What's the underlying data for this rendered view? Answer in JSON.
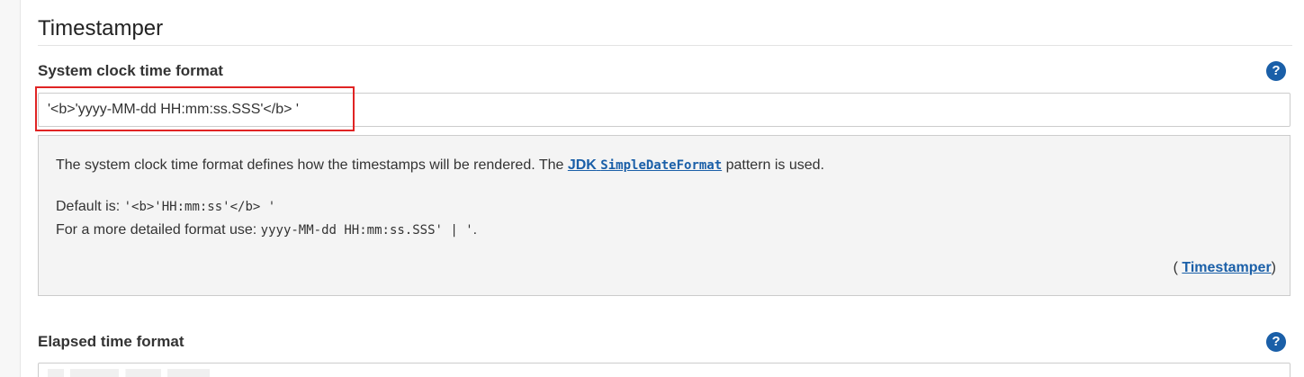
{
  "section": {
    "title": "Timestamper"
  },
  "system_clock": {
    "label": "System clock time format",
    "value": "'<b>'yyyy-MM-dd HH:mm:ss.SSS'</b> '",
    "help_icon": "question-circle-icon",
    "help": {
      "line1_prefix": "The system clock time format defines how the timestamps will be rendered. The ",
      "link_jdk": "JDK",
      "link_class": "SimpleDateFormat",
      "line1_suffix": " pattern is used.",
      "default_prefix": "Default is: ",
      "default_code": "'<b>'HH:mm:ss'</b> '",
      "detail_prefix": "For a more detailed format use: ",
      "detail_code": "yyyy-MM-dd HH:mm:ss.SSS' | '",
      "detail_suffix": ".",
      "credit_open": "(",
      "credit_link": "Timestamper",
      "credit_close": ")"
    }
  },
  "elapsed": {
    "label": "Elapsed time format",
    "help_icon": "question-circle-icon"
  },
  "colors": {
    "link": "#1a5fa8",
    "highlight": "#e02424",
    "help_bg": "#f4f4f4"
  }
}
